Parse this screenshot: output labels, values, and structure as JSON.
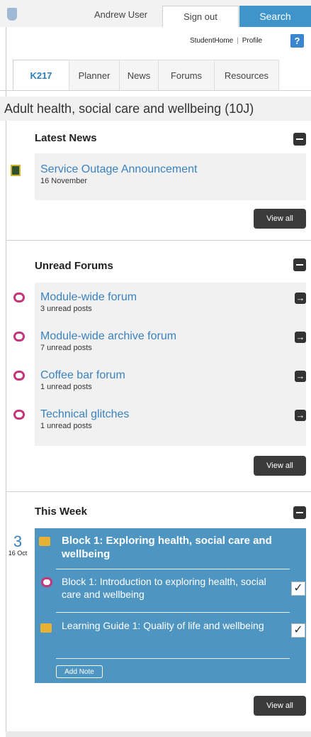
{
  "header": {
    "username": "Andrew User",
    "signout_label": "Sign out",
    "search_label": "Search",
    "links": [
      "StudentHome",
      "Profile"
    ],
    "help_label": "?"
  },
  "tabs": [
    "K217",
    "Planner",
    "News",
    "Forums",
    "Resources"
  ],
  "module_title": "Adult health, social care and wellbeing (10J)",
  "latest_news": {
    "title": "Latest News",
    "items": [
      {
        "title": "Service Outage Announcement",
        "sub": "16 November"
      }
    ],
    "view_all": "View all"
  },
  "unread_forums": {
    "title": "Unread Forums",
    "items": [
      {
        "title": "Module-wide forum",
        "sub": "3 unread posts"
      },
      {
        "title": "Module-wide archive forum",
        "sub": "7 unread posts"
      },
      {
        "title": "Coffee bar forum",
        "sub": "1 unread posts"
      },
      {
        "title": "Technical glitches",
        "sub": "1 unread posts"
      }
    ],
    "view_all": "View all"
  },
  "this_week": {
    "title": "This Week",
    "date_day": "3",
    "date_month": "16 Oct",
    "block_title": "Block 1: Exploring health, social care and wellbeing",
    "items": [
      {
        "title": "Block 1: Introduction to exploring health, social care and wellbeing",
        "checked": true
      },
      {
        "title": "Learning Guide 1: Quality of life and wellbeing",
        "checked": true
      }
    ],
    "add_note": "Add Note",
    "view_all": "View all"
  },
  "colors": {
    "accent": "#3f95c9",
    "link": "#3a82bf",
    "week_panel": "#4e95c2",
    "forum_icon": "#c4357a"
  }
}
